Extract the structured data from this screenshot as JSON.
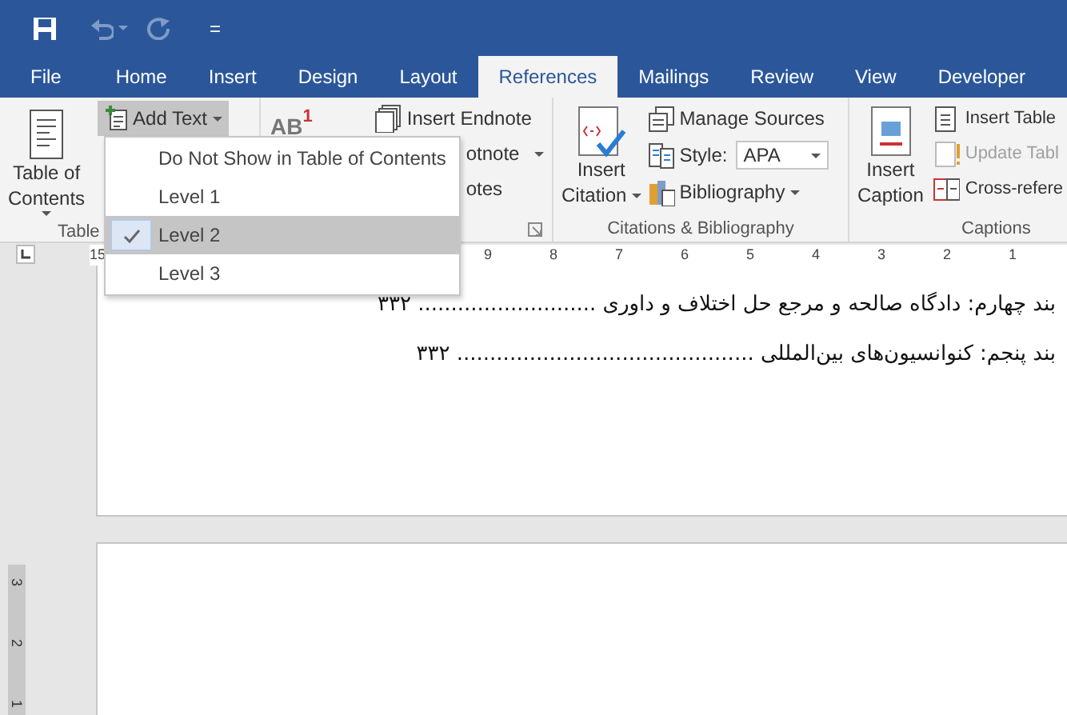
{
  "quick_access": {
    "customize": "="
  },
  "tabs": [
    {
      "label": "File",
      "selected": false
    },
    {
      "label": "Home",
      "selected": false
    },
    {
      "label": "Insert",
      "selected": false
    },
    {
      "label": "Design",
      "selected": false
    },
    {
      "label": "Layout",
      "selected": false
    },
    {
      "label": "References",
      "selected": true
    },
    {
      "label": "Mailings",
      "selected": false
    },
    {
      "label": "Review",
      "selected": false
    },
    {
      "label": "View",
      "selected": false
    },
    {
      "label": "Developer",
      "selected": false
    }
  ],
  "ribbon": {
    "toc": {
      "big_button": [
        "Table of",
        "Contents"
      ],
      "add_text": "Add Text",
      "group_label": "Table"
    },
    "footnotes": {
      "big_icon": "AB",
      "big_icon_sup": "1",
      "insert_endnote": "Insert Endnote",
      "next_footnote": "otnote",
      "show_notes": "otes"
    },
    "citations": {
      "insert_citation": [
        "Insert",
        "Citation"
      ],
      "manage_sources": "Manage Sources",
      "style_label": "Style:",
      "style_value": "APA",
      "bibliography": "Bibliography",
      "group_label": "Citations & Bibliography"
    },
    "captions": {
      "insert_caption": [
        "Insert",
        "Caption"
      ],
      "items": [
        {
          "label": "Insert Table",
          "disabled": false
        },
        {
          "label": "Update Tabl",
          "disabled": true
        },
        {
          "label": "Cross-refere",
          "disabled": false
        }
      ],
      "group_label": "Captions"
    }
  },
  "add_text_menu": [
    {
      "label": "Do Not Show in Table of Contents",
      "selected": false
    },
    {
      "label": "Level 1",
      "selected": false
    },
    {
      "label": "Level 2",
      "selected": true
    },
    {
      "label": "Level 3",
      "selected": false
    }
  ],
  "ruler": {
    "left_number": "15",
    "numbers": [
      "9",
      "8",
      "7",
      "6",
      "5",
      "4",
      "3",
      "2",
      "1"
    ]
  },
  "vertical_ruler": {
    "numbers": [
      "3",
      "2",
      "1"
    ]
  },
  "document": {
    "toc_lines": [
      {
        "text": "بند چهارم: دادگاه صالحه و مرجع حل اختلاف و داوری",
        "leader": "...........................",
        "page": "۳۳۲"
      },
      {
        "text": "بند پنجم: کنوانسیون‌های بین‌المللی",
        "leader": ".............................................",
        "page": "۳۳۲"
      }
    ]
  }
}
